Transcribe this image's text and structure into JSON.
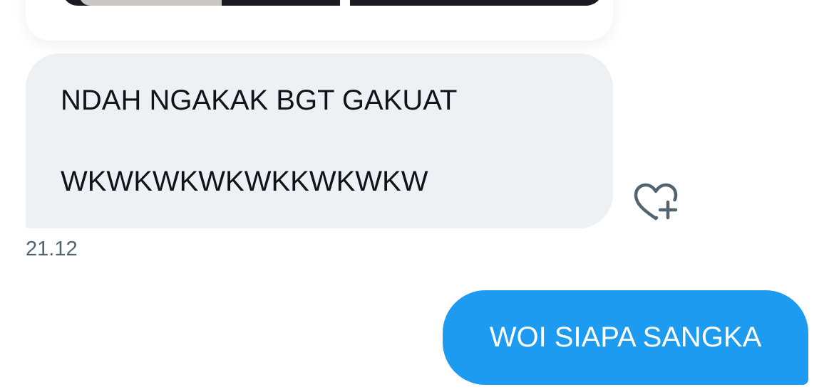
{
  "conversation": {
    "received_message": {
      "line1": "NDAH NGAKAK BGT GAKUAT",
      "line2": "WKWKWKWKWKKWKWKW",
      "timestamp": "21.12"
    },
    "sent_message": {
      "text": "WOI SIAPA SANGKA"
    }
  },
  "icons": {
    "react": "heart-plus-icon"
  },
  "colors": {
    "sent_bubble": "#1d9bf0",
    "received_bubble": "#eef1f3",
    "text_primary": "#0f1419",
    "text_secondary": "#536471"
  }
}
